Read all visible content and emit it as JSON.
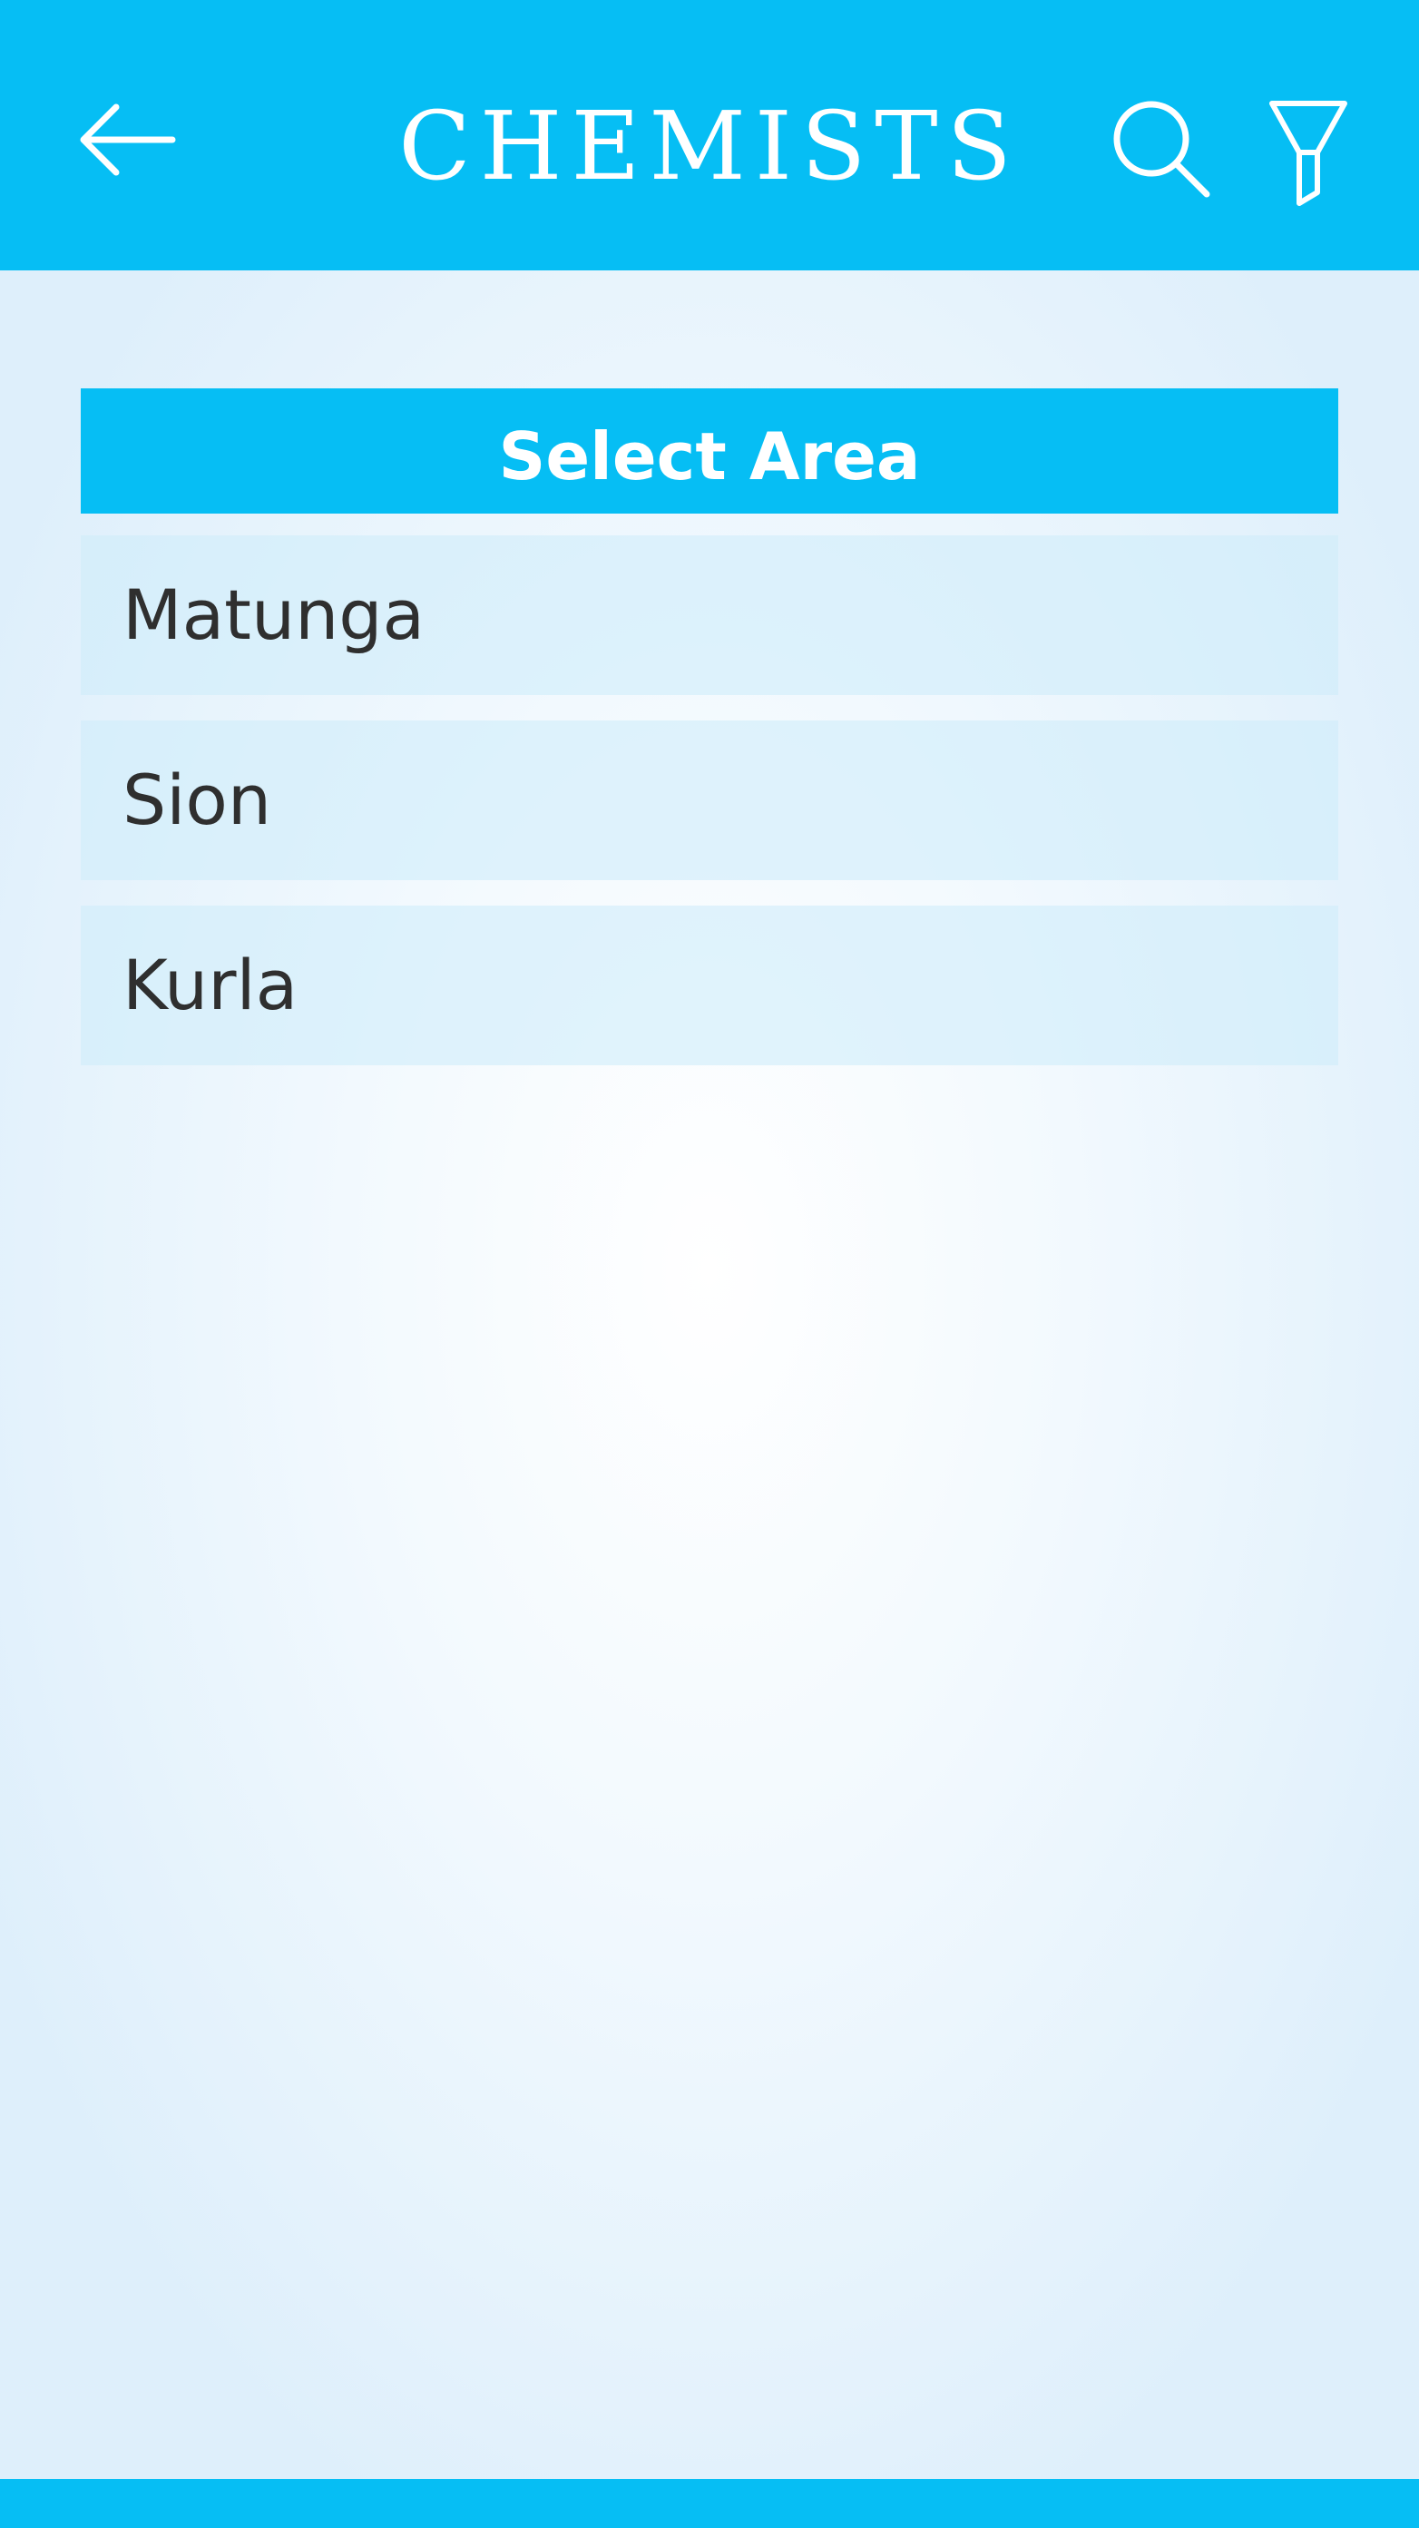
{
  "app_bar": {
    "title": "CHEMISTS",
    "back_icon": "arrow-left-icon",
    "search_icon": "search-icon",
    "filter_icon": "filter-icon",
    "color": "#06bef4"
  },
  "select_area": {
    "header": "Select Area",
    "items": [
      {
        "label": "Matunga"
      },
      {
        "label": "Sion"
      },
      {
        "label": "Kurla"
      }
    ]
  },
  "colors": {
    "accent": "#06bef4",
    "item_background": "#d9eefa",
    "text": "#2f2f2f"
  }
}
